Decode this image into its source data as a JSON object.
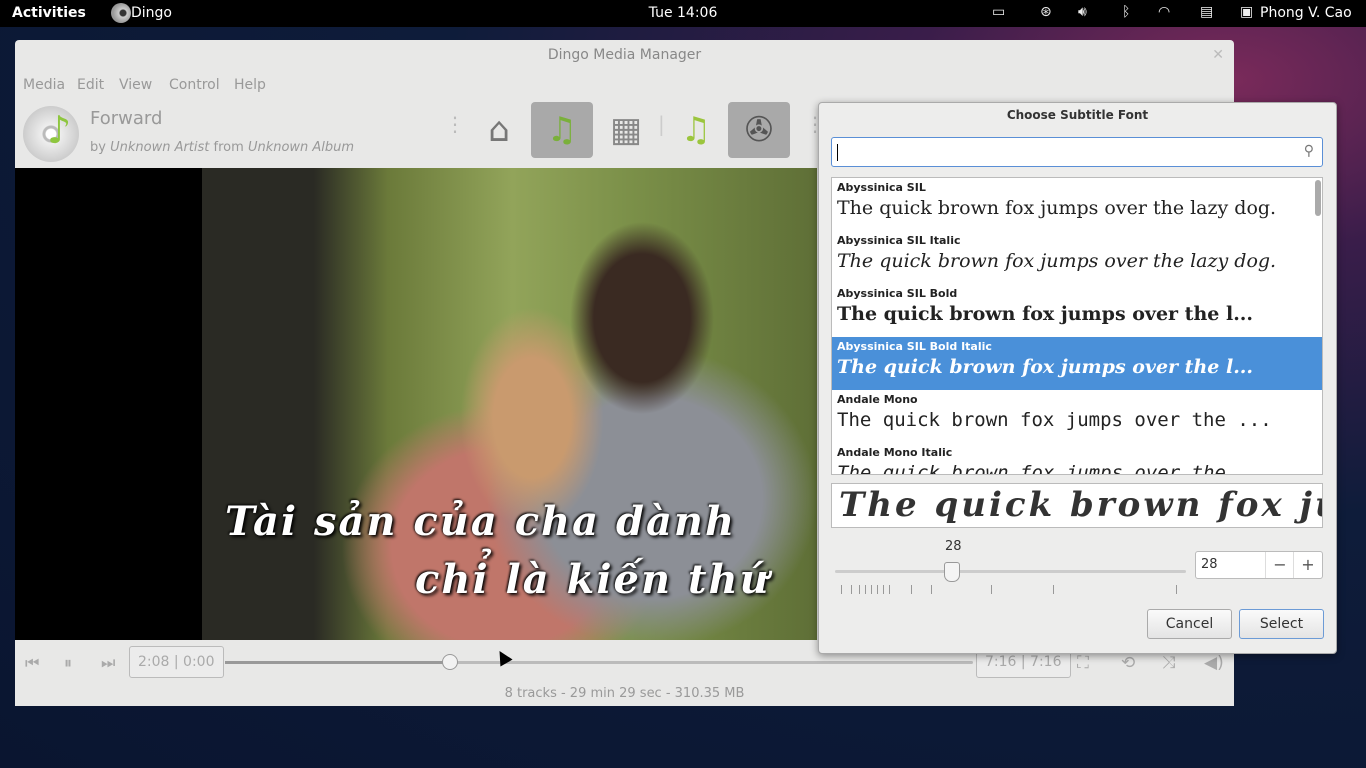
{
  "topbar": {
    "activities": "Activities",
    "app_name": "Dingo",
    "clock": "Tue 14:06",
    "user": "Phong V. Cao"
  },
  "window": {
    "title": "Dingo Media Manager",
    "menu": [
      "Media",
      "Edit",
      "View",
      "Control",
      "Help"
    ]
  },
  "track": {
    "title": "Forward",
    "by": "by",
    "artist": "Unknown Artist",
    "from": "from",
    "album": "Unknown Album"
  },
  "subtitles": {
    "line1": "Tài sản của cha dành",
    "line2": "chỉ là kiến thứ"
  },
  "player": {
    "elapsed": "2:08 | 0:00",
    "total": "7:16 | 7:16",
    "progress": 0.3,
    "status": "8 tracks - 29 min 29 sec - 310.35 MB"
  },
  "dialog": {
    "title": "Choose Subtitle Font",
    "search_value": "",
    "sample": "The quick brown fox jumps over the lazy dog.",
    "fonts": [
      {
        "name": "Abyssinica SIL",
        "sample": "The quick brown fox jumps over the lazy dog.",
        "style": ""
      },
      {
        "name": "Abyssinica SIL Italic",
        "sample": "The quick brown fox jumps over the lazy dog.",
        "style": "it"
      },
      {
        "name": "Abyssinica SIL Bold",
        "sample": "The quick brown fox jumps over the l...",
        "style": "bd"
      },
      {
        "name": "Abyssinica SIL Bold Italic",
        "sample": "The quick brown fox jumps over the l...",
        "style": "bd it",
        "selected": true
      },
      {
        "name": "Andale Mono",
        "sample": "The quick brown fox jumps over the ...",
        "style": "mono"
      },
      {
        "name": "Andale Mono Italic",
        "sample": "The quick brown fox jumps over the ...",
        "style": "mono it"
      }
    ],
    "preview": "The quick brown fox jui",
    "size_label": "28",
    "size_value": "28",
    "size_fraction": 0.33,
    "cancel": "Cancel",
    "select": "Select",
    "minus": "−",
    "plus": "+"
  }
}
